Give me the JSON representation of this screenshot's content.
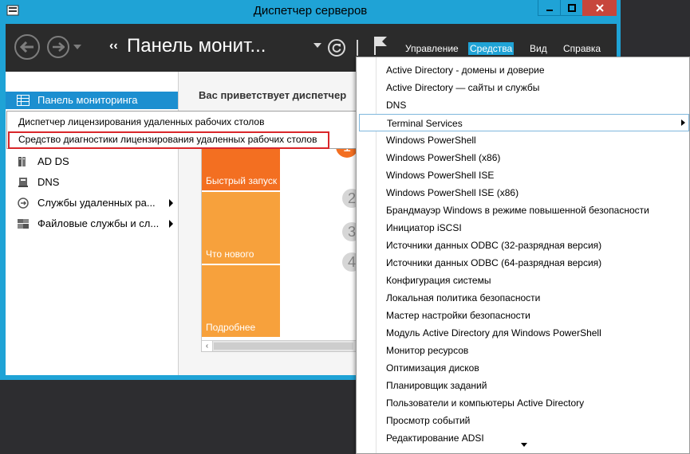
{
  "window": {
    "title": "Диспетчер серверов",
    "accent": "#1fa3d6",
    "close_color": "#c7463c"
  },
  "header": {
    "breadcrumb_arrows": "‹‹",
    "breadcrumb_title": "Панель монит...",
    "menus": {
      "manage": "Управление",
      "tools": "Средства",
      "view": "Вид",
      "help": "Справка"
    }
  },
  "sidebar": {
    "dashboard_label": "Панель мониторинга",
    "items": [
      {
        "label": "AD DS",
        "icon": "server-role-icon",
        "has_arrow": false
      },
      {
        "label": "DNS",
        "icon": "dns-icon",
        "has_arrow": false
      },
      {
        "label": "Службы удаленных ра...",
        "icon": "remote-desktop-icon",
        "has_arrow": true
      },
      {
        "label": "Файловые службы и сл...",
        "icon": "file-services-icon",
        "has_arrow": true
      }
    ]
  },
  "main": {
    "welcome": "Вас приветствует диспетчер",
    "tiles": {
      "quick_start": "Быстрый запуск",
      "whats_new": "Что нового",
      "learn_more": "Подробнее"
    },
    "steps": [
      "1",
      "2",
      "3",
      "4"
    ]
  },
  "context_menu": {
    "items": [
      "Диспетчер лицензирования удаленных рабочих столов",
      "Средство диагностики лицензирования удаленных рабочих столов"
    ],
    "highlight_color": "#d9262a"
  },
  "tools_menu": {
    "items": [
      "Active Directory - домены и доверие",
      "Active Directory — сайты и службы",
      "DNS",
      "Terminal Services",
      "Windows PowerShell",
      "Windows PowerShell (x86)",
      "Windows PowerShell ISE",
      "Windows PowerShell ISE (x86)",
      "Брандмауэр Windows в режиме повышенной безопасности",
      "Инициатор iSCSI",
      "Источники данных ODBC (32-разрядная версия)",
      "Источники данных ODBC (64-разрядная версия)",
      "Конфигурация системы",
      "Локальная политика безопасности",
      "Мастер настройки безопасности",
      "Модуль Active Directory для Windows PowerShell",
      "Монитор ресурсов",
      "Оптимизация дисков",
      "Планировщик заданий",
      "Пользователи и компьютеры Active Directory",
      "Просмотр событий",
      "Редактирование ADSI"
    ],
    "highlighted_index": 3,
    "submenu_index": 3
  }
}
